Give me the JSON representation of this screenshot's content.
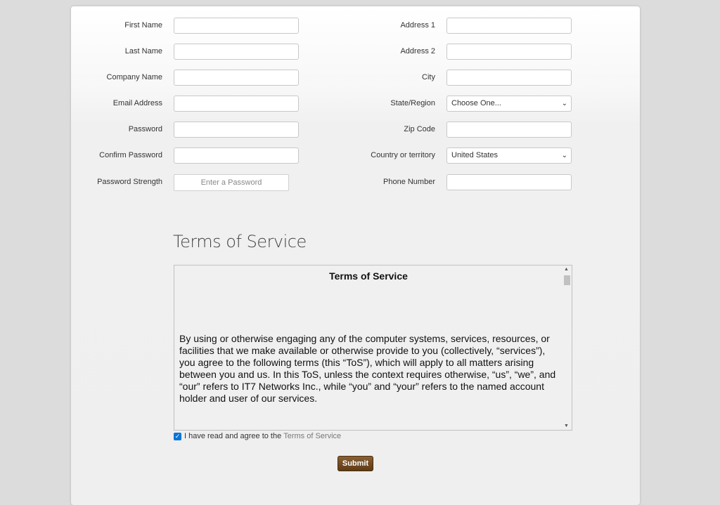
{
  "left_fields": [
    {
      "label": "First Name",
      "value": ""
    },
    {
      "label": "Last Name",
      "value": ""
    },
    {
      "label": "Company Name",
      "value": ""
    },
    {
      "label": "Email Address",
      "value": ""
    },
    {
      "label": "Password",
      "value": ""
    },
    {
      "label": "Confirm Password",
      "value": ""
    }
  ],
  "password_strength": {
    "label": "Password Strength",
    "text": "Enter a Password"
  },
  "right_fields": {
    "address1": {
      "label": "Address 1",
      "value": ""
    },
    "address2": {
      "label": "Address 2",
      "value": ""
    },
    "city": {
      "label": "City",
      "value": ""
    },
    "state": {
      "label": "State/Region",
      "selected": "Choose One..."
    },
    "zip": {
      "label": "Zip Code",
      "value": ""
    },
    "country": {
      "label": "Country or territory",
      "selected": "United States"
    },
    "phone": {
      "label": "Phone Number",
      "value": ""
    }
  },
  "tos": {
    "heading": "Terms of Service",
    "box_title": "Terms of Service",
    "body": "By using or otherwise engaging any of the computer systems, services, resources, or facilities that we make available or otherwise provide to you (collectively, “services”), you agree to the following terms (this “ToS”), which will apply to all matters arising between you and us. In this ToS, unless the context requires otherwise, “us”, “we”, and “our” refers to IT7 Networks Inc., while “you” and “your” refers to the named account holder and user of our services."
  },
  "agree": {
    "text": "I have read and agree to the",
    "link": "Terms of Service",
    "checked": true
  },
  "submit_label": "Submit",
  "colors": {
    "submit": "#6b4420",
    "checkbox": "#0a75d6",
    "background": "#dcdcdc"
  }
}
